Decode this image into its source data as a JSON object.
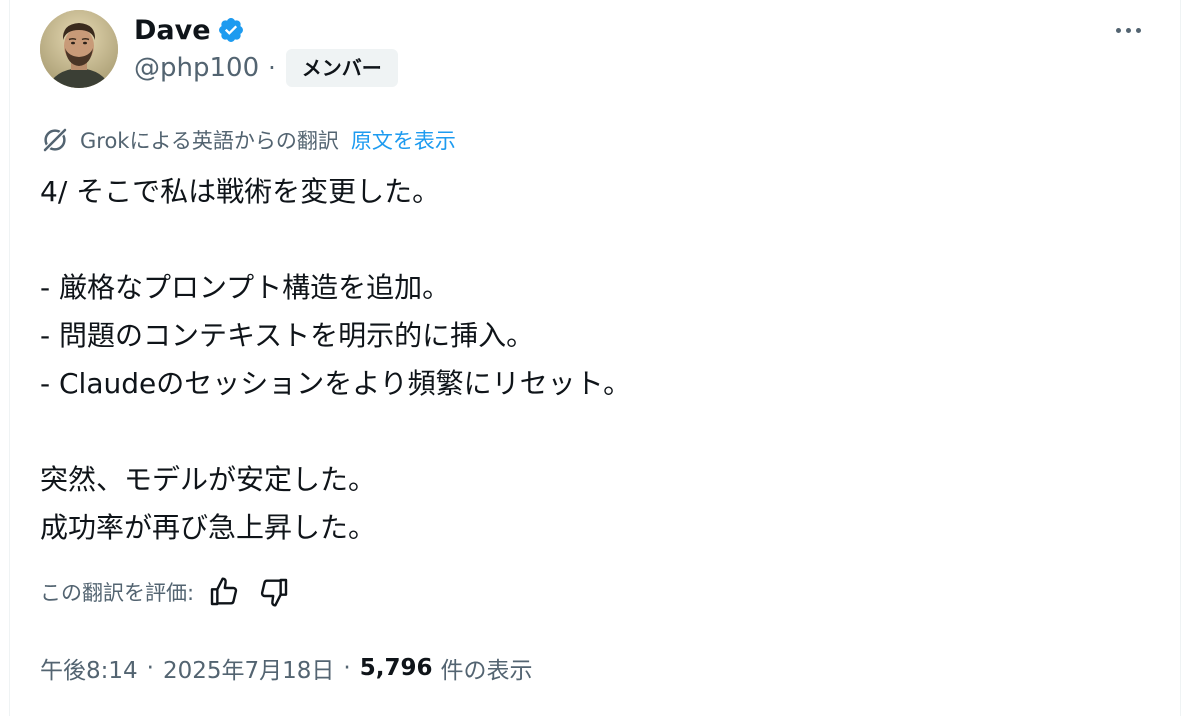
{
  "author": {
    "display_name": "Dave",
    "handle": "@php100",
    "separator": "·",
    "badge": "メンバー",
    "verified": true,
    "avatar_icon": "avatar-portrait"
  },
  "translation": {
    "icon": "grok-icon",
    "note": "Grokによる英語からの翻訳",
    "show_original": "原文を表示"
  },
  "body_lines": [
    "4/ そこで私は戦術を変更した。",
    "",
    "- 厳格なプロンプト構造を追加。",
    "- 問題のコンテキストを明示的に挿入。",
    "- Claudeのセッションをより頻繁にリセット。",
    "",
    "突然、モデルが安定した。",
    "成功率が再び急上昇した。"
  ],
  "rating": {
    "label": "この翻訳を評価:",
    "up_icon": "thumbs-up-icon",
    "down_icon": "thumbs-down-icon"
  },
  "meta": {
    "time": "午後8:14",
    "date": "2025年7月18日",
    "separator": "·",
    "views_count": "5,796",
    "views_label": "件の表示"
  },
  "colors": {
    "text_primary": "#0f1419",
    "text_secondary": "#536471",
    "link": "#1d9bf0",
    "verified": "#1d9bf0",
    "badge_bg": "#eff3f4"
  }
}
